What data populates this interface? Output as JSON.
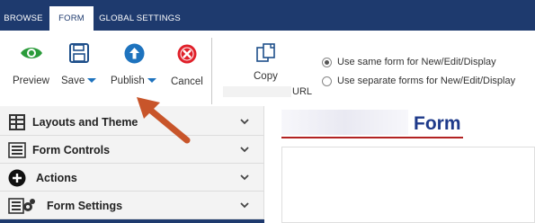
{
  "tabs": {
    "browse": "BROWSE",
    "form": "FORM",
    "global_settings": "GLOBAL SETTINGS"
  },
  "ribbon": {
    "preview": "Preview",
    "save": "Save",
    "publish": "Publish",
    "cancel": "Cancel",
    "copy": "Copy",
    "url": "URL",
    "radio_same": "Use same form for New/Edit/Display",
    "radio_separate": "Use separate forms for New/Edit/Display",
    "radio_same_checked": true
  },
  "panel": {
    "items": [
      {
        "label": "Layouts and Theme",
        "icon": "layouts-icon"
      },
      {
        "label": "Form Controls",
        "icon": "form-controls-icon"
      },
      {
        "label": "Actions",
        "icon": "actions-plus-icon"
      },
      {
        "label": "Form Settings",
        "icon": "form-settings-gear-icon"
      }
    ]
  },
  "canvas": {
    "title": "Form"
  },
  "colors": {
    "brand": "#1e3a6e",
    "accent_blue": "#1e73be",
    "cancel_red": "#e0202a",
    "preview_green": "#2a9b3a",
    "annotation_arrow": "#c8552a"
  }
}
